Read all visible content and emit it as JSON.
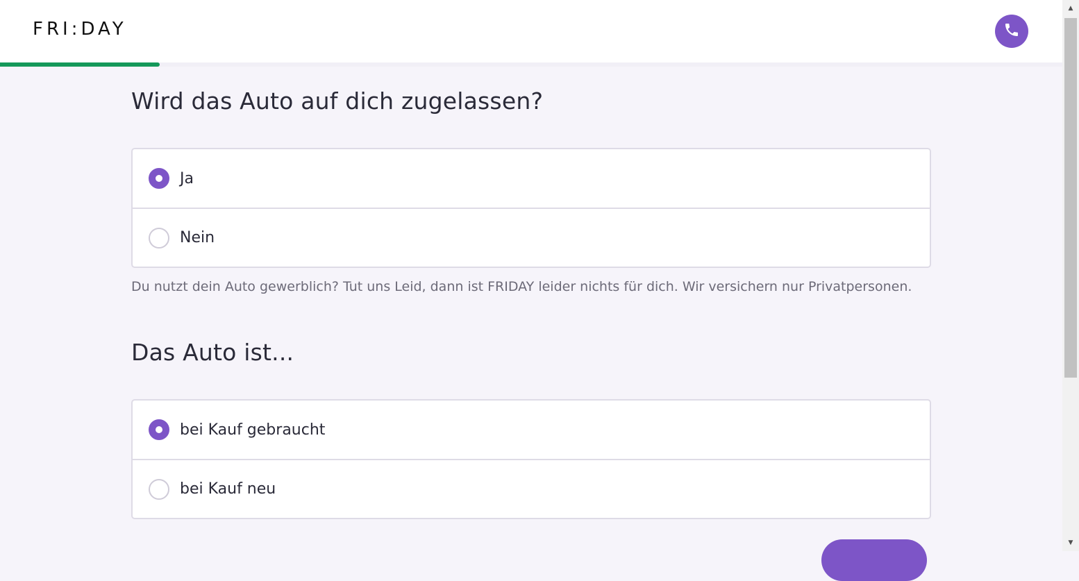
{
  "brand": {
    "logo_text": "FRI:DAY",
    "accent": "#7d55c7",
    "progress_color": "#15985a"
  },
  "header": {
    "phone_icon": "phone-icon"
  },
  "progress": {
    "fraction": 0.15
  },
  "questions": [
    {
      "title": "Wird das Auto auf dich zugelassen?",
      "options": [
        {
          "label": "Ja",
          "selected": true
        },
        {
          "label": "Nein",
          "selected": false
        }
      ],
      "note": "Du nutzt dein Auto gewerblich? Tut uns Leid, dann ist FRIDAY leider nichts für dich. Wir versichern nur Privatpersonen."
    },
    {
      "title": "Das Auto ist...",
      "options": [
        {
          "label": "bei Kauf gebraucht",
          "selected": true
        },
        {
          "label": "bei Kauf neu",
          "selected": false
        }
      ]
    }
  ]
}
